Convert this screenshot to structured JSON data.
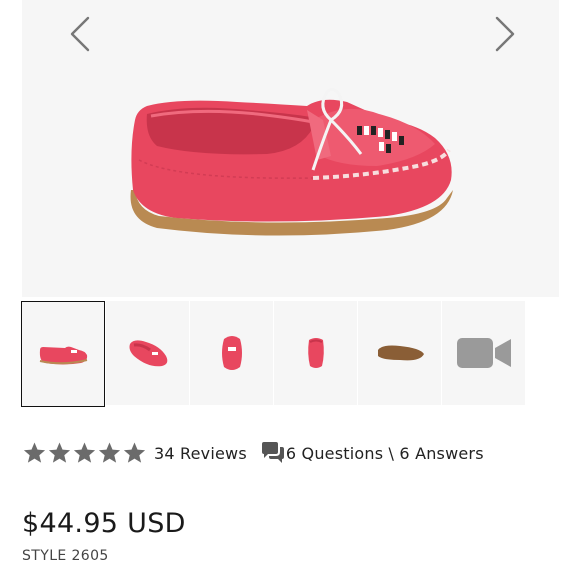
{
  "gallery": {
    "prev_icon": "chevron-left-icon",
    "next_icon": "chevron-right-icon",
    "main_image": "pink-moccasin-side-view",
    "thumbnails": [
      {
        "name": "thumb-side-view",
        "active": true
      },
      {
        "name": "thumb-angled-view",
        "active": false
      },
      {
        "name": "thumb-front-view",
        "active": false
      },
      {
        "name": "thumb-back-view",
        "active": false
      },
      {
        "name": "thumb-sole-view",
        "active": false
      },
      {
        "name": "thumb-video",
        "icon": "video-camera-icon",
        "active": false
      }
    ]
  },
  "rating": {
    "stars": 5,
    "reviews_label": "34 Reviews",
    "qa_icon": "chat-bubbles-icon",
    "qa_label": "6 Questions \\ 6 Answers"
  },
  "product": {
    "price": "$44.95 USD",
    "style": "STYLE 2605"
  },
  "colors": {
    "shoe_pink": "#e8475f",
    "sole_tan": "#b98a52",
    "star_gray": "#6b6b6b",
    "arrow_gray": "#777777"
  }
}
